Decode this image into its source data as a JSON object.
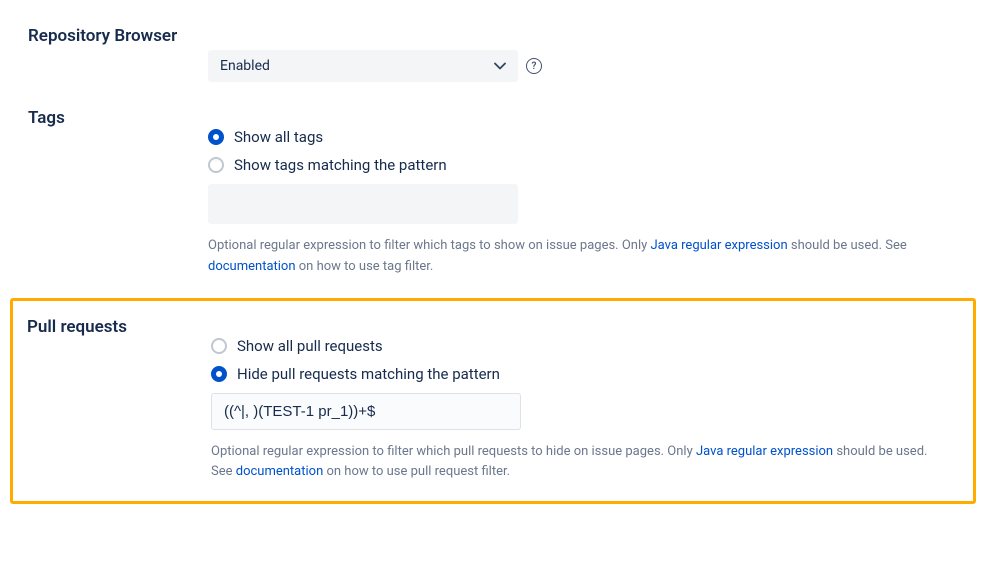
{
  "repoBrowser": {
    "label": "Repository Browser",
    "selectValue": "Enabled"
  },
  "tags": {
    "label": "Tags",
    "optionAll": "Show all tags",
    "optionPattern": "Show tags matching the pattern",
    "inputValue": "",
    "helpPrefix": "Optional regular expression to filter which tags to show on issue pages. Only ",
    "helpLink1": "Java regular expression",
    "helpMid": " should be used. See ",
    "helpLink2": "documentation",
    "helpSuffix": " on how to use tag filter."
  },
  "pullRequests": {
    "label": "Pull requests",
    "optionAll": "Show all pull requests",
    "optionPattern": "Hide pull requests matching the pattern",
    "inputValue": "((^|, )(TEST-1 pr_1))+$",
    "helpPrefix": "Optional regular expression to filter which pull requests to hide on issue pages. Only ",
    "helpLink1": "Java regular expression",
    "helpMid": " should be used. See ",
    "helpLink2": "documentation",
    "helpSuffix": " on how to use pull request filter."
  }
}
